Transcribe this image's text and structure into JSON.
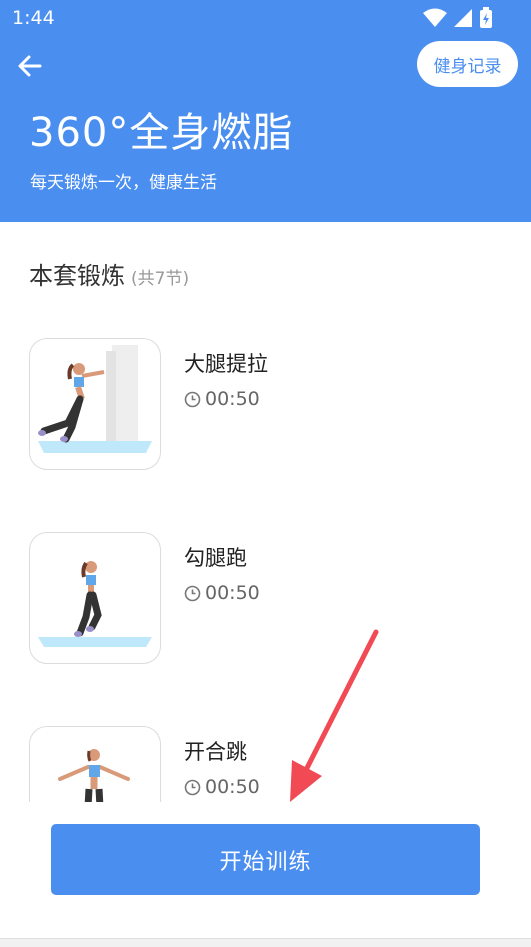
{
  "status_bar": {
    "time": "1:44"
  },
  "header": {
    "record_button": "健身记录",
    "title": "360°全身燃脂",
    "subtitle": "每天锻炼一次，健康生活"
  },
  "section": {
    "title": "本套锻炼",
    "count": "(共7节)"
  },
  "exercises": [
    {
      "name": "大腿提拉",
      "duration": "00:50"
    },
    {
      "name": "勾腿跑",
      "duration": "00:50"
    },
    {
      "name": "开合跳",
      "duration": "00:50"
    }
  ],
  "start_button": "开始训练",
  "colors": {
    "primary": "#4a8ef0",
    "annotation_arrow": "#f24a55"
  }
}
